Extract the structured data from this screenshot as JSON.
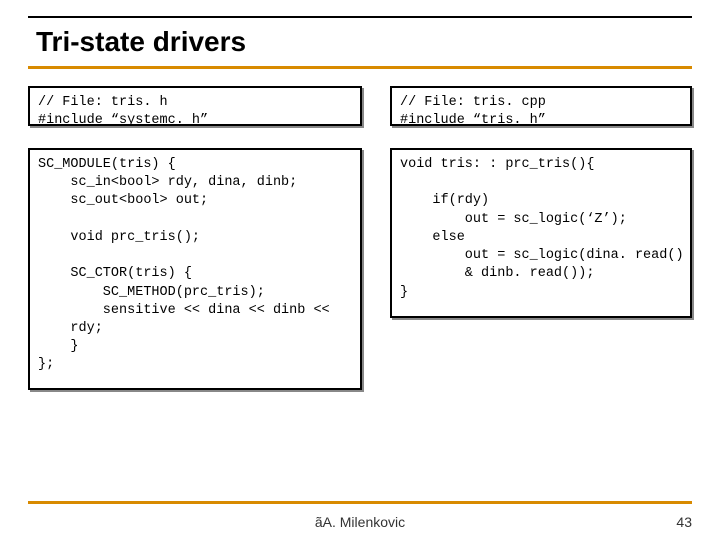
{
  "title": "Tri-state drivers",
  "code": {
    "left_header": "// File: tris. h\n#include “systemc. h”",
    "right_header": "// File: tris. cpp\n#include “tris. h”",
    "left_body": "SC_MODULE(tris) {\n    sc_in<bool> rdy, dina, dinb;\n    sc_out<bool> out;\n\n    void prc_tris();\n\n    SC_CTOR(tris) {\n        SC_METHOD(prc_tris);\n        sensitive << dina << dinb <<\n    rdy;\n    }\n};",
    "right_body": "void tris: : prc_tris(){\n\n    if(rdy)\n        out = sc_logic(‘Z’);\n    else\n        out = sc_logic(dina. read()\n        & dinb. read());\n}"
  },
  "footer": {
    "copyright_symbol": "ã",
    "copyright_text": "A. Milenkovic",
    "page": "43"
  }
}
